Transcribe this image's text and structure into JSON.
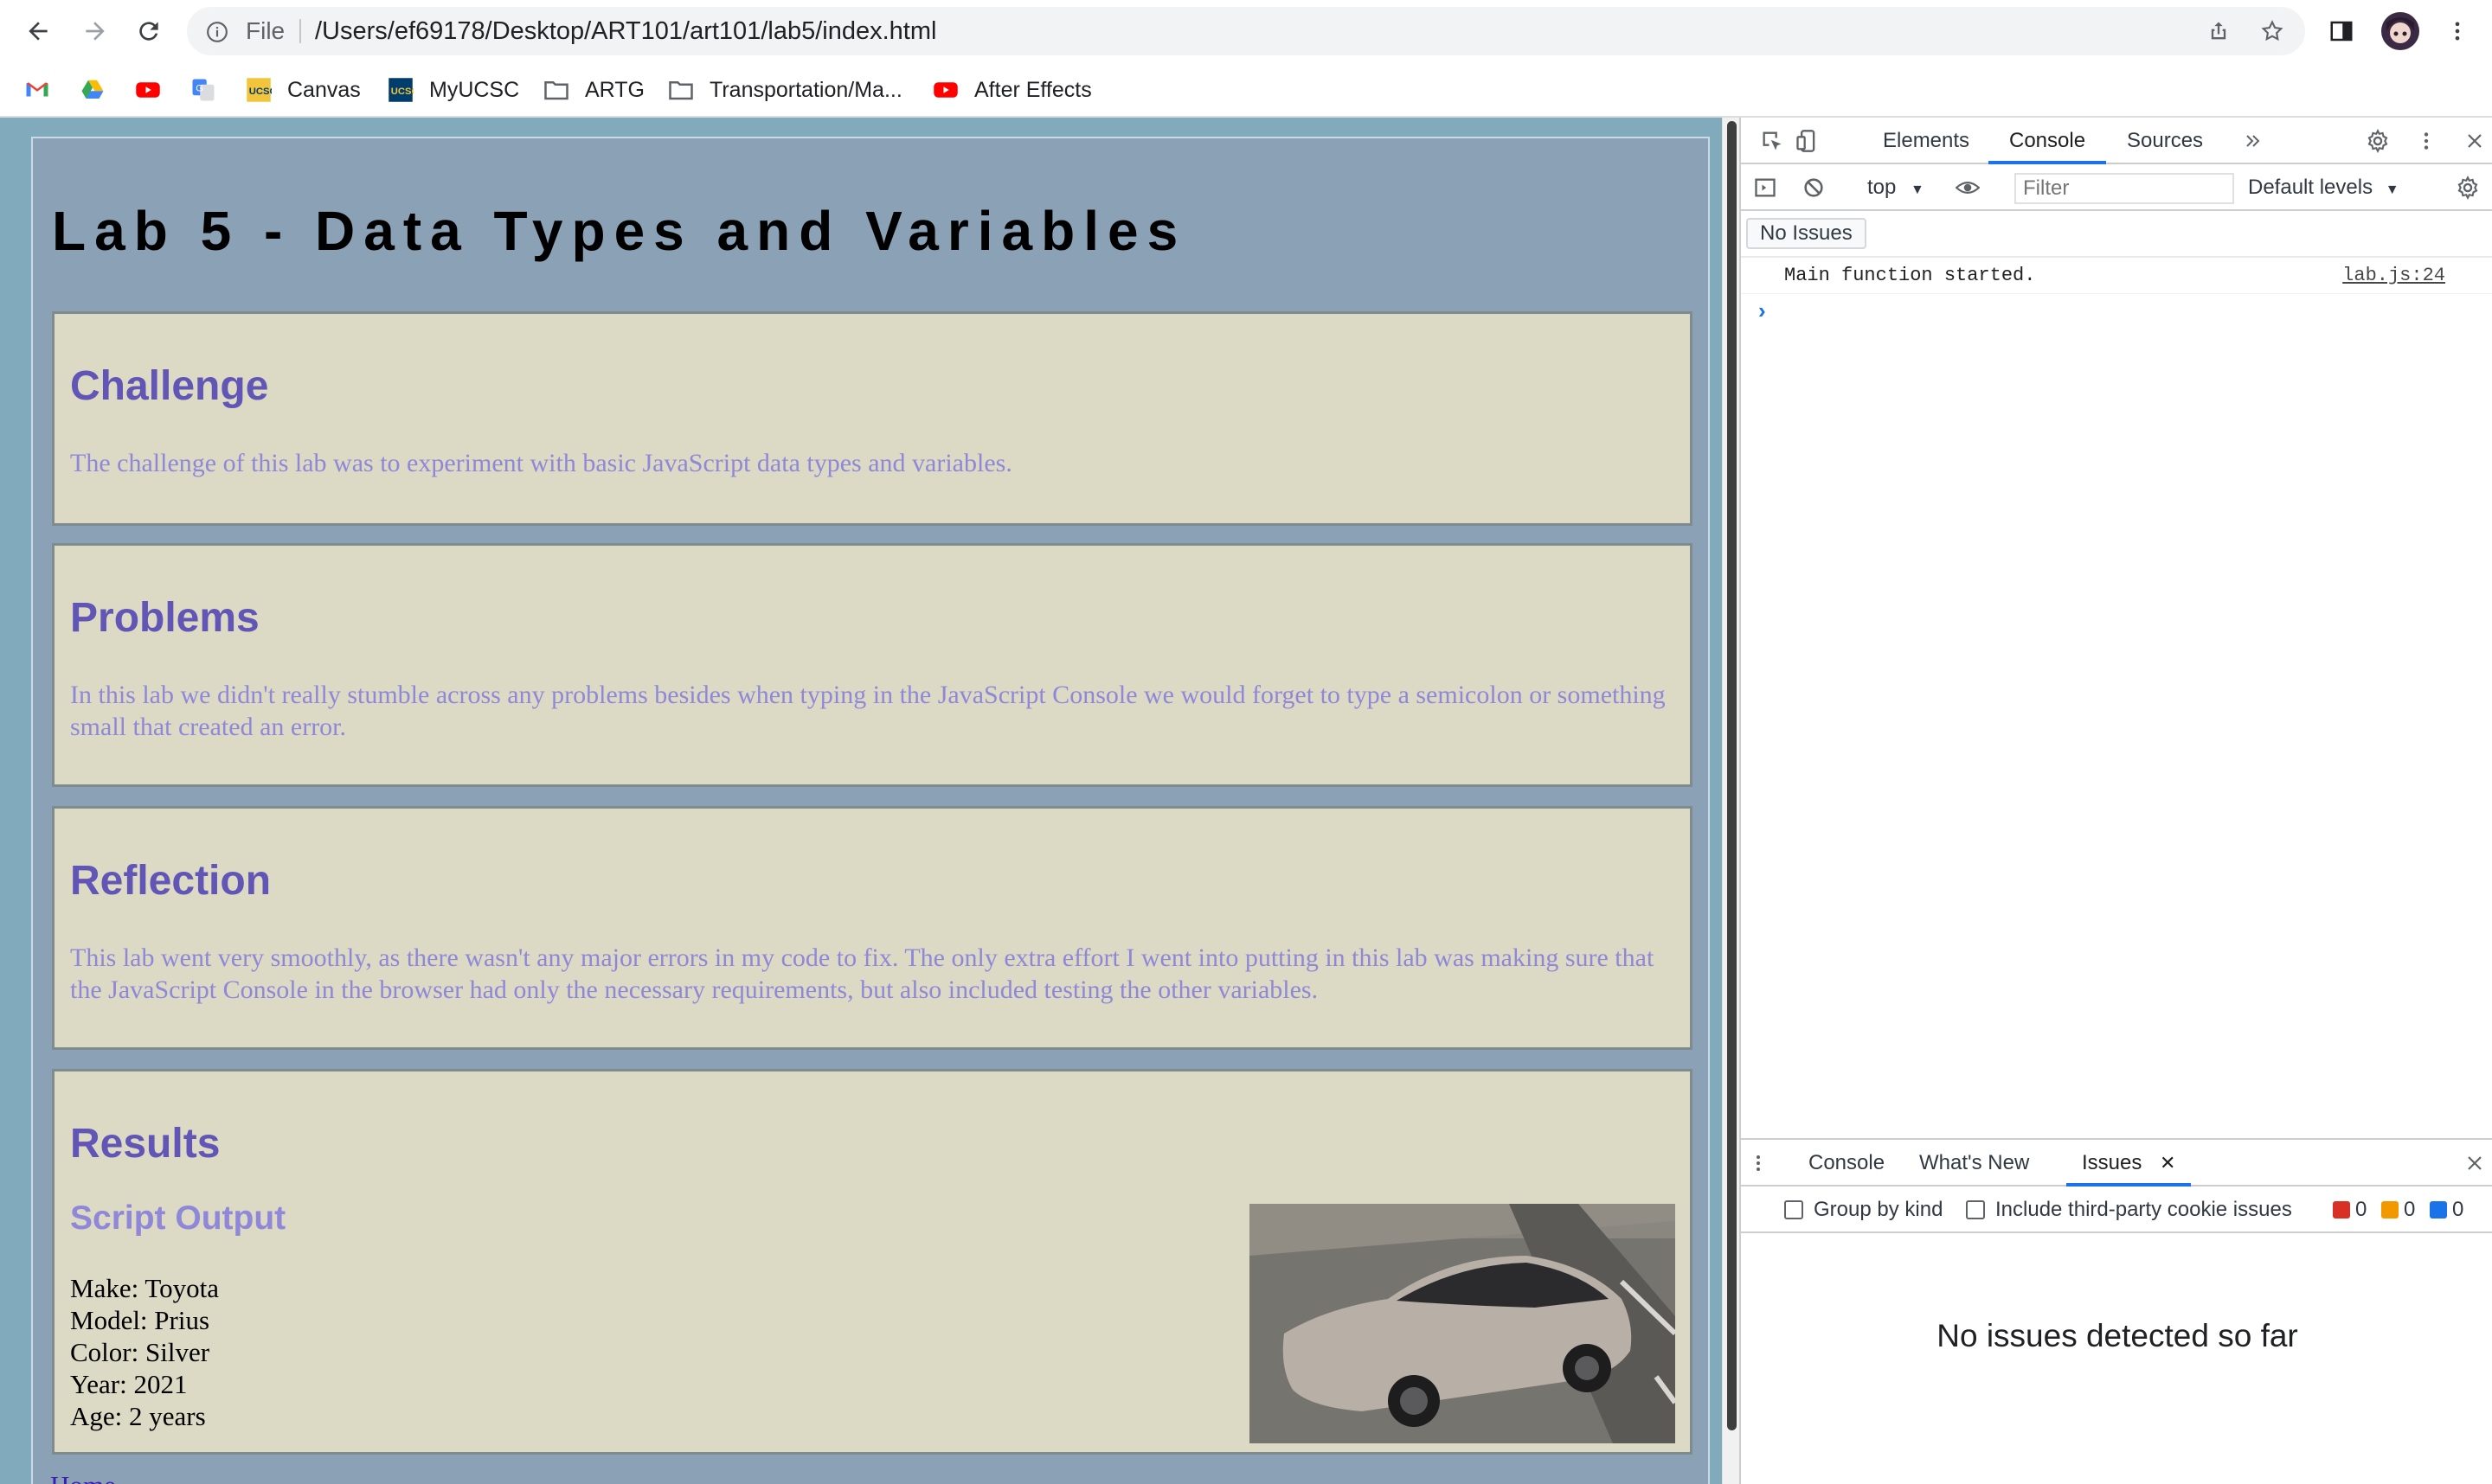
{
  "browser": {
    "file_label": "File",
    "url": "/Users/ef69178/Desktop/ART101/art101/lab5/index.html"
  },
  "bookmarks": [
    {
      "label": "",
      "icon": "gmail-icon"
    },
    {
      "label": "",
      "icon": "google-drive-icon"
    },
    {
      "label": "",
      "icon": "youtube-icon"
    },
    {
      "label": "",
      "icon": "google-translate-icon"
    },
    {
      "label": "Canvas",
      "icon": "ucsc-icon"
    },
    {
      "label": "MyUCSC",
      "icon": "ucsc-icon"
    },
    {
      "label": "ARTG",
      "icon": "folder-icon"
    },
    {
      "label": "Transportation/Ma...",
      "icon": "folder-icon"
    },
    {
      "label": "After Effects",
      "icon": "youtube-icon"
    }
  ],
  "page": {
    "title": "Lab 5 - Data Types and Variables",
    "challenge": {
      "heading": "Challenge",
      "text": "The challenge of this lab was to experiment with basic JavaScript data types and variables."
    },
    "problems": {
      "heading": "Problems",
      "text": "In this lab we didn't really stumble across any problems besides when typing in the JavaScript Console we would forget to type a semicolon or something small that created an error."
    },
    "reflection": {
      "heading": "Reflection",
      "text": "This lab went very smoothly, as there wasn't any major errors in my code to fix. The only extra effort I went into putting in this lab was making sure that the JavaScript Console in the browser had only the necessary requirements, but also included testing the other variables."
    },
    "results": {
      "heading": "Results",
      "subheading": "Script Output",
      "lines": [
        "Make: Toyota",
        "Model: Prius",
        "Color: Silver",
        "Year: 2021",
        "Age: 2 years"
      ]
    },
    "footer_link": "Home"
  },
  "devtools": {
    "tabs": [
      "Elements",
      "Console",
      "Sources"
    ],
    "active_tab": "Console",
    "context": "top",
    "filter_placeholder": "Filter",
    "levels": "Default levels",
    "no_issues_button": "No Issues",
    "log": {
      "message": "Main function started.",
      "source": "lab.js:24"
    },
    "drawer": {
      "tabs": [
        "Console",
        "What's New",
        "Issues"
      ],
      "active_tab": "Issues",
      "group_by_kind": "Group by kind",
      "third_party": "Include third-party cookie issues",
      "counts": {
        "errors": "0",
        "warnings": "0",
        "info": "0"
      },
      "empty_message": "No issues detected so far"
    }
  },
  "colors": {
    "page_bg": "#82aabd",
    "wrapper_bg": "#8ba1b6",
    "section_bg": "#dcd9c5",
    "heading": "#6155b6",
    "body_text": "#8f88d8",
    "devtools_accent": "#1a73e8"
  }
}
